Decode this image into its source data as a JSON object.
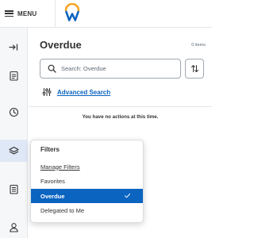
{
  "header": {
    "menu_label": "MENU",
    "logo": "workday-logo",
    "brand_colors": {
      "arc": "#f5a623",
      "letter": "#0b64c0"
    }
  },
  "rail": {
    "items": [
      {
        "icon": "collapse-arrow-icon"
      },
      {
        "icon": "clipboard-icon"
      },
      {
        "icon": "clock-icon"
      },
      {
        "icon": "layers-icon",
        "active": true
      },
      {
        "icon": "document-icon"
      },
      {
        "icon": "person-icon"
      }
    ]
  },
  "main": {
    "title": "Overdue",
    "items_count": "0 items",
    "search_placeholder": "Search: Overdue",
    "advanced_search_label": "Advanced Search",
    "empty_message": "You have no actions at this time."
  },
  "filters": {
    "title": "Filters",
    "manage_label": "Manage Filters",
    "options": [
      "Favorites",
      "Overdue",
      "Delegated to Me"
    ],
    "selected": "Overdue"
  },
  "colors": {
    "accent": "#0b64c0",
    "rail_bg": "#f6f7f8",
    "rail_active": "#dfe8f6"
  }
}
